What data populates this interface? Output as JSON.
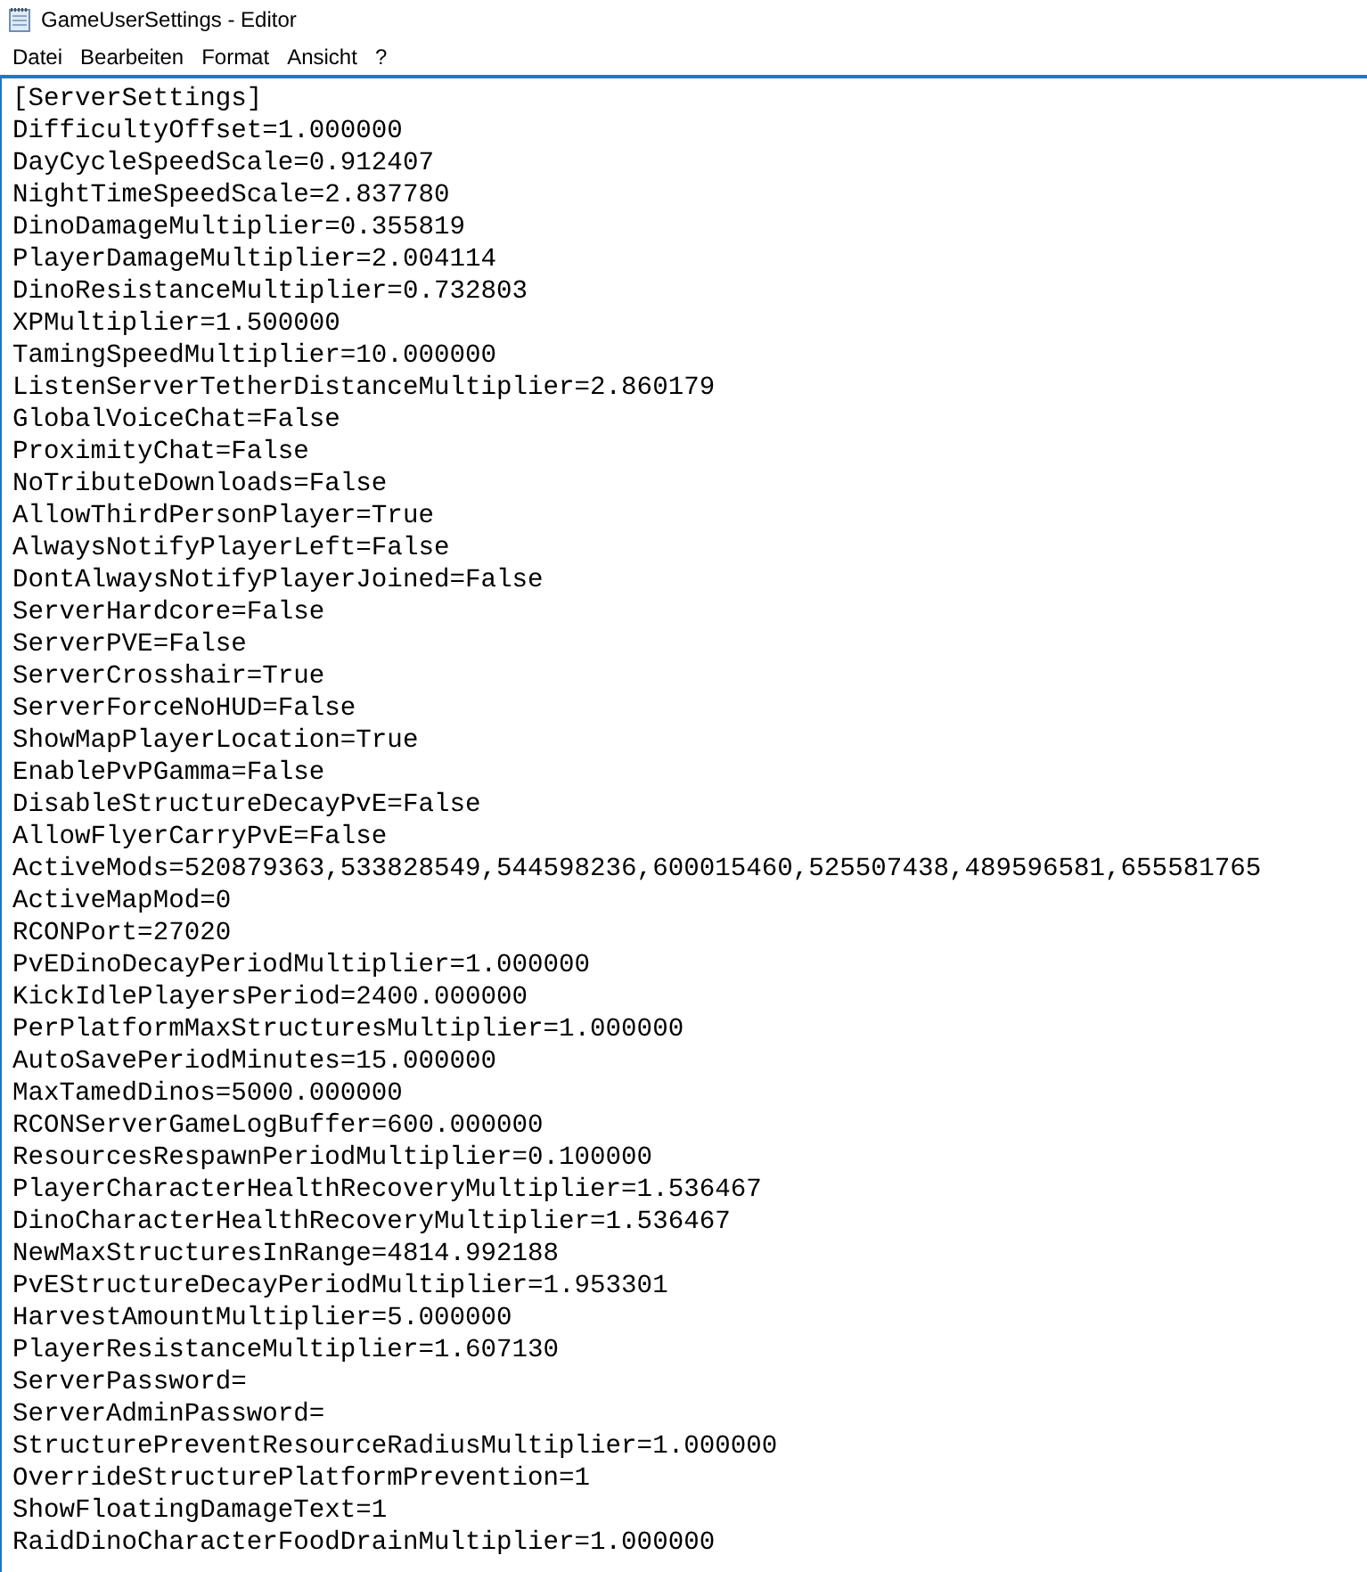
{
  "window": {
    "title": "GameUserSettings - Editor"
  },
  "menu": [
    "Datei",
    "Bearbeiten",
    "Format",
    "Ansicht",
    "?"
  ],
  "editor": {
    "lines": [
      "[ServerSettings]",
      "DifficultyOffset=1.000000",
      "DayCycleSpeedScale=0.912407",
      "NightTimeSpeedScale=2.837780",
      "DinoDamageMultiplier=0.355819",
      "PlayerDamageMultiplier=2.004114",
      "DinoResistanceMultiplier=0.732803",
      "XPMultiplier=1.500000",
      "TamingSpeedMultiplier=10.000000",
      "ListenServerTetherDistanceMultiplier=2.860179",
      "GlobalVoiceChat=False",
      "ProximityChat=False",
      "NoTributeDownloads=False",
      "AllowThirdPersonPlayer=True",
      "AlwaysNotifyPlayerLeft=False",
      "DontAlwaysNotifyPlayerJoined=False",
      "ServerHardcore=False",
      "ServerPVE=False",
      "ServerCrosshair=True",
      "ServerForceNoHUD=False",
      "ShowMapPlayerLocation=True",
      "EnablePvPGamma=False",
      "DisableStructureDecayPvE=False",
      "AllowFlyerCarryPvE=False",
      "ActiveMods=520879363,533828549,544598236,600015460,525507438,489596581,655581765",
      "ActiveMapMod=0",
      "RCONPort=27020",
      "PvEDinoDecayPeriodMultiplier=1.000000",
      "KickIdlePlayersPeriod=2400.000000",
      "PerPlatformMaxStructuresMultiplier=1.000000",
      "AutoSavePeriodMinutes=15.000000",
      "MaxTamedDinos=5000.000000",
      "RCONServerGameLogBuffer=600.000000",
      "ResourcesRespawnPeriodMultiplier=0.100000",
      "PlayerCharacterHealthRecoveryMultiplier=1.536467",
      "DinoCharacterHealthRecoveryMultiplier=1.536467",
      "NewMaxStructuresInRange=4814.992188",
      "PvEStructureDecayPeriodMultiplier=1.953301",
      "HarvestAmountMultiplier=5.000000",
      "PlayerResistanceMultiplier=1.607130",
      "ServerPassword=",
      "ServerAdminPassword=",
      "StructurePreventResourceRadiusMultiplier=1.000000",
      "OverrideStructurePlatformPrevention=1",
      "ShowFloatingDamageText=1",
      "RaidDinoCharacterFoodDrainMultiplier=1.000000"
    ]
  }
}
